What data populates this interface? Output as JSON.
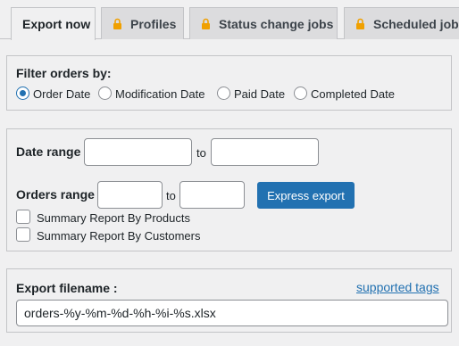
{
  "tabs": [
    {
      "label": "Export now",
      "locked": false,
      "active": true
    },
    {
      "label": "Profiles",
      "locked": true,
      "active": false
    },
    {
      "label": "Status change jobs",
      "locked": true,
      "active": false
    },
    {
      "label": "Scheduled jobs",
      "locked": true,
      "active": false
    }
  ],
  "filter": {
    "title": "Filter orders by:",
    "options": [
      {
        "label": "Order Date",
        "checked": true
      },
      {
        "label": "Modification Date",
        "checked": false
      },
      {
        "label": "Paid Date",
        "checked": false
      },
      {
        "label": "Completed Date",
        "checked": false
      }
    ]
  },
  "date_range": {
    "label": "Date range",
    "to_label": "to",
    "from_value": "",
    "to_value": ""
  },
  "orders_range": {
    "label": "Orders range",
    "to_label": "to",
    "from_value": "",
    "to_value": "",
    "button_label": "Express export"
  },
  "checkboxes": [
    {
      "label": "Summary Report By Products",
      "checked": false
    },
    {
      "label": "Summary Report By Customers",
      "checked": false
    }
  ],
  "export_filename": {
    "label": "Export filename :",
    "link": "supported tags",
    "value": "orders-%y-%m-%d-%h-%i-%s.xlsx"
  },
  "colors": {
    "accent": "#2271b1",
    "lock": "#f0a000",
    "background": "#f0f0f1"
  },
  "icons": {
    "lock": "lock-icon"
  }
}
